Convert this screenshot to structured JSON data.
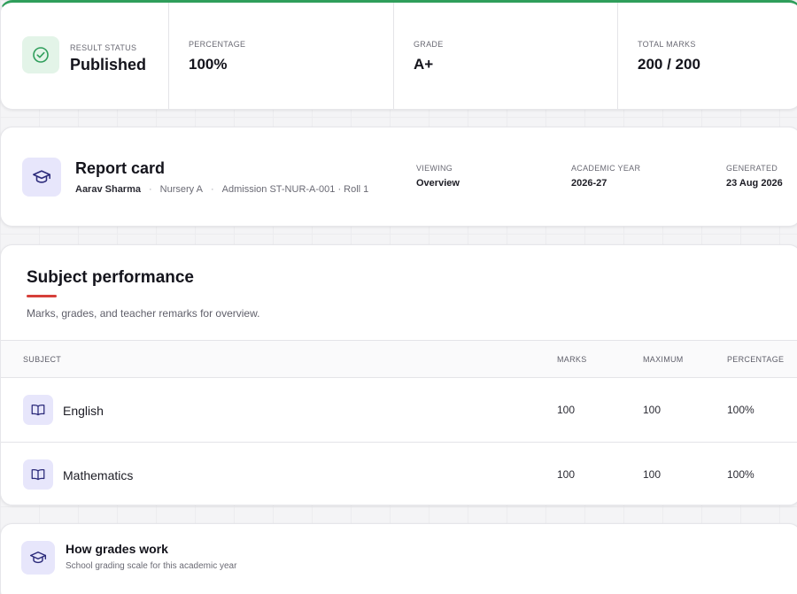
{
  "status": {
    "result_status_label": "RESULT STATUS",
    "result_status_value": "Published",
    "percentage_label": "PERCENTAGE",
    "percentage_value": "100%",
    "grade_label": "GRADE",
    "grade_value": "A+",
    "total_marks_label": "TOTAL MARKS",
    "total_marks_value": "200 / 200"
  },
  "report": {
    "title": "Report card",
    "student_name": "Aarav Sharma",
    "class_name": "Nursery A",
    "admission": "Admission ST-NUR-A-001 · Roll 1",
    "viewing_label": "VIEWING",
    "viewing_value": "Overview",
    "academic_year_label": "ACADEMIC YEAR",
    "academic_year_value": "2026-27",
    "generated_label": "GENERATED",
    "generated_value": "23 Aug 2026"
  },
  "subjects": {
    "title": "Subject performance",
    "subtitle": "Marks, grades, and teacher remarks for overview.",
    "columns": {
      "subject": "SUBJECT",
      "marks": "MARKS",
      "maximum": "MAXIMUM",
      "percentage": "PERCENTAGE"
    },
    "rows": [
      {
        "name": "English",
        "marks": "100",
        "maximum": "100",
        "percentage": "100%"
      },
      {
        "name": "Mathematics",
        "marks": "100",
        "maximum": "100",
        "percentage": "100%"
      }
    ]
  },
  "grades_info": {
    "title": "How grades work",
    "subtitle": "School grading scale for this academic year"
  },
  "colors": {
    "accent_green": "#2f9e5b",
    "accent_red": "#d63f3a",
    "icon_indigo": "#2b2a7a"
  },
  "icons": {
    "status": "check-circle-icon",
    "report": "graduation-cap-icon",
    "subject": "book-open-icon",
    "grades": "graduation-cap-icon"
  }
}
